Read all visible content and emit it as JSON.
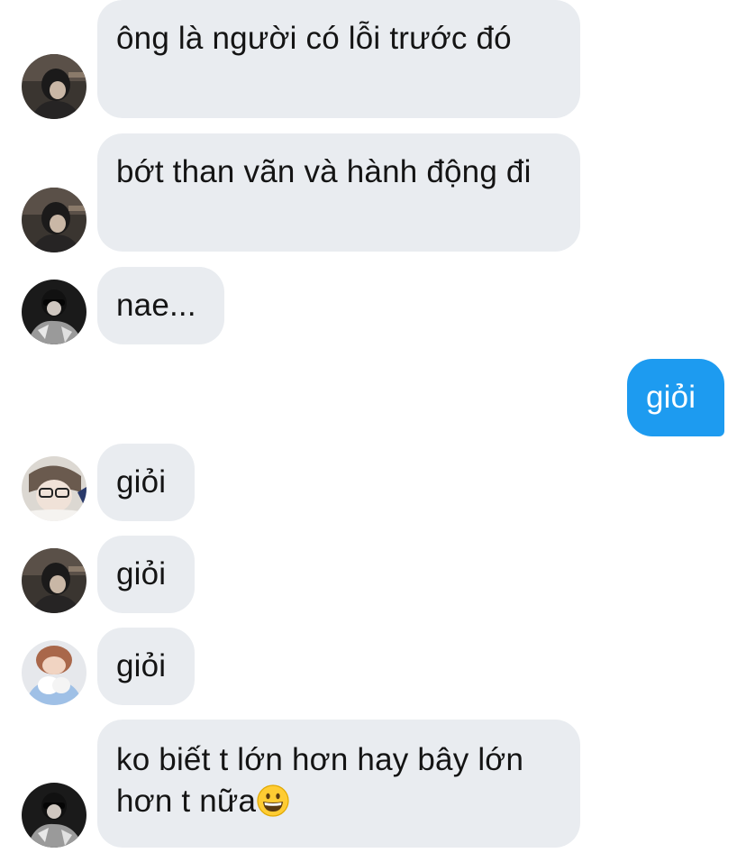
{
  "conversation": {
    "messages": [
      {
        "direction": "in",
        "avatar": "avatar-user-a",
        "text": "ông là người có lỗi trước đó"
      },
      {
        "direction": "in",
        "avatar": "avatar-user-a",
        "text": "bớt than vãn và hành động đi"
      },
      {
        "direction": "in",
        "avatar": "avatar-user-b",
        "text": "nae..."
      },
      {
        "direction": "out",
        "avatar": null,
        "text": "giỏi"
      },
      {
        "direction": "in",
        "avatar": "avatar-user-c",
        "text": "giỏi"
      },
      {
        "direction": "in",
        "avatar": "avatar-user-a",
        "text": "giỏi"
      },
      {
        "direction": "in",
        "avatar": "avatar-user-d",
        "text": "giỏi"
      },
      {
        "direction": "in",
        "avatar": "avatar-user-b",
        "text": "ko biết t lớn hơn hay bây lớn hơn t nữa",
        "emoji": "grinning-face-emoji"
      }
    ]
  },
  "colors": {
    "incoming_bubble": "#e9ecf0",
    "outgoing_bubble": "#1d9bf0",
    "incoming_text": "#141414",
    "outgoing_text": "#ffffff"
  }
}
